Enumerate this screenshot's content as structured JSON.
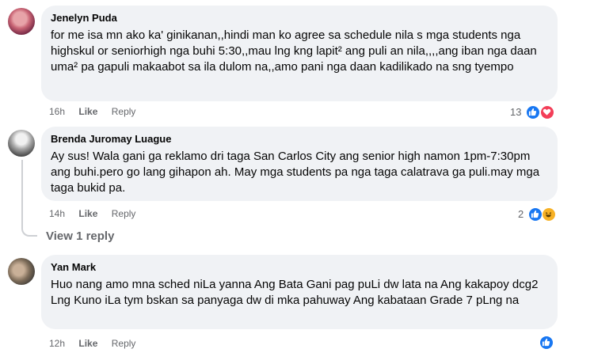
{
  "comments": [
    {
      "author": "Jenelyn Puda",
      "text": "for me isa mn ako ka' ginikanan,,hindi man ko agree sa schedule nila s mga students nga highskul or seniorhigh nga buhi 5:30,,mau lng kng lapit² ang puli an nila,,,,ang iban nga daan uma² pa gapuli makaabot sa ila dulom na,,amo pani nga daan kadilikado na sng tyempo",
      "time": "16h",
      "like_label": "Like",
      "reply_label": "Reply",
      "reaction_count": "13",
      "reactions": [
        "like-icon",
        "love-icon"
      ]
    },
    {
      "author": "Brenda Juromay Luague",
      "text": "Ay sus! Wala gani ga reklamo dri taga San Carlos City ang senior high namon 1pm-7:30pm ang buhi.pero go lang gihapon ah. May mga students pa nga taga calatrava ga puli.may mga taga bukid pa.",
      "time": "14h",
      "like_label": "Like",
      "reply_label": "Reply",
      "reaction_count": "2",
      "reactions": [
        "like-icon",
        "haha-icon"
      ]
    },
    {
      "author": "Yan Mark",
      "text": "Huo nang amo mna sched niLa yanna Ang Bata Gani pag puLi dw lata na Ang kakapoy dcg2 Lng Kuno iLa tym bskan sa panyaga dw di mka pahuway Ang kabataan Grade 7 pLng na",
      "time": "12h",
      "like_label": "Like",
      "reply_label": "Reply",
      "reaction_count": "",
      "reactions": [
        "like-icon"
      ]
    }
  ],
  "view_replies_label": "View 1 reply",
  "colors": {
    "bubble_bg": "#f0f2f5",
    "meta_text": "#65676b",
    "like_blue": "#1877f2",
    "love_red": "#f33e58",
    "haha_yellow": "#f7b125"
  }
}
